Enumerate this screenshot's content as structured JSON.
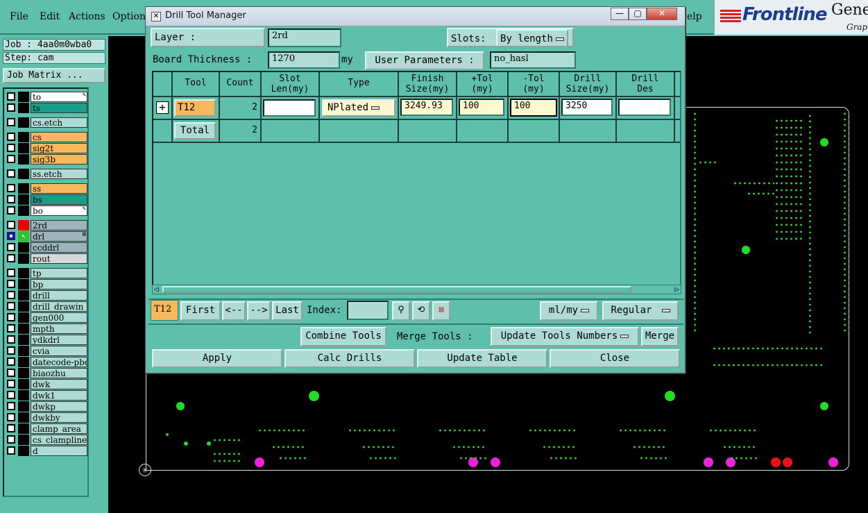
{
  "menubar": {
    "items": [
      "File",
      "Edit",
      "Actions",
      "Options"
    ],
    "help_fragment": "elp"
  },
  "logo": {
    "brand": "Frontline",
    "gen_fragment": "Gene",
    "grap_fragment": "Grap"
  },
  "job": {
    "job_line": "Job : 4aa0m0wba0",
    "step_line": "Step: cam",
    "matrix_button": "Job Matrix ..."
  },
  "layers": [
    {
      "name": "to",
      "color": "#ffffff",
      "mark": "✎"
    },
    {
      "name": "ts",
      "color": "#1a9e8a",
      "mark": ""
    },
    {
      "name": "cs.etch",
      "color": "#aedbd3",
      "mark": ""
    },
    {
      "name": "cs",
      "color": "#f6b85c",
      "mark": ""
    },
    {
      "name": "sig2t",
      "color": "#f6b85c",
      "mark": ""
    },
    {
      "name": "sig3b",
      "color": "#f6b85c",
      "mark": ""
    },
    {
      "name": "ss.etch",
      "color": "#aedbd3",
      "mark": ""
    },
    {
      "name": "ss",
      "color": "#f6b85c",
      "mark": ""
    },
    {
      "name": "bs",
      "color": "#1a9e8a",
      "mark": ""
    },
    {
      "name": "bo",
      "color": "#ffffff",
      "mark": "✎"
    },
    {
      "name": "2rd",
      "color": "#9fb3bd",
      "mark": ""
    },
    {
      "name": "drl",
      "color": "#9fb3bd",
      "mark": "⊞"
    },
    {
      "name": "ccddrl",
      "color": "#9fb3bd",
      "mark": ""
    },
    {
      "name": "rout",
      "color": "#d8d8d8",
      "mark": ""
    },
    {
      "name": "tp",
      "color": "#aedbd3",
      "mark": ""
    },
    {
      "name": "bp",
      "color": "#aedbd3",
      "mark": ""
    },
    {
      "name": "drill",
      "color": "#aedbd3",
      "mark": ""
    },
    {
      "name": "drill_drawin",
      "color": "#aedbd3",
      "mark": ""
    },
    {
      "name": "gen000",
      "color": "#aedbd3",
      "mark": ""
    },
    {
      "name": "mpth",
      "color": "#aedbd3",
      "mark": ""
    },
    {
      "name": "ydkdrl",
      "color": "#aedbd3",
      "mark": ""
    },
    {
      "name": "cvia",
      "color": "#aedbd3",
      "mark": ""
    },
    {
      "name": "datecode-pbo",
      "color": "#aedbd3",
      "mark": ""
    },
    {
      "name": "biaozhu",
      "color": "#aedbd3",
      "mark": ""
    },
    {
      "name": "dwk",
      "color": "#aedbd3",
      "mark": ""
    },
    {
      "name": "dwk1",
      "color": "#aedbd3",
      "mark": ""
    },
    {
      "name": "dwkp",
      "color": "#aedbd3",
      "mark": ""
    },
    {
      "name": "dwkby",
      "color": "#aedbd3",
      "mark": ""
    },
    {
      "name": "clamp_area",
      "color": "#aedbd3",
      "mark": ""
    },
    {
      "name": "cs_clampline",
      "color": "#aedbd3",
      "mark": ""
    },
    {
      "name": "d",
      "color": "#aedbd3",
      "mark": ""
    }
  ],
  "dialog": {
    "title": "Drill Tool Manager",
    "title_buttons": {
      "minimize": "—",
      "maximize": "▢",
      "close": "✕"
    },
    "layer_label": "Layer      :",
    "layer_value": "2rd",
    "slots_label": "Slots:",
    "slots_value": "By length",
    "board_thickness_label": "Board Thickness :",
    "board_thickness_value": "1270",
    "board_thickness_unit": "my",
    "user_params_label": "User Parameters :",
    "user_params_value": "no_hasl",
    "table": {
      "headers": [
        {
          "text": "Tool"
        },
        {
          "text": "Count"
        },
        {
          "text": "Slot\nLen(my)"
        },
        {
          "text": "Type"
        },
        {
          "text": "Finish\nSize(my)"
        },
        {
          "text": "+Tol\n(my)"
        },
        {
          "text": "-Tol\n(my)"
        },
        {
          "text": "Drill\nSize(my)"
        },
        {
          "text": "Drill\nDes"
        }
      ],
      "rows": [
        {
          "expand": "+",
          "tool": "T12",
          "count": "2",
          "slot_len": "",
          "type": "NPlated",
          "finish_size": "3249.93",
          "plus_tol": "100",
          "minus_tol": "100",
          "drill_size": "3250",
          "drill_des": ""
        }
      ],
      "total_label": "Total",
      "total_count": "2"
    },
    "nav": {
      "current_tool": "T12",
      "first": "First",
      "prev": "<--",
      "next": "-->",
      "last": "Last",
      "index_label": "Index:",
      "index_value": "",
      "units": "ml/my",
      "mode": "Regular"
    },
    "tools_row": {
      "combine": "Combine Tools",
      "merge_label": "Merge Tools :",
      "merge_option": "Update Tools Numbers",
      "merge_button": "Merge"
    },
    "actions": {
      "apply": "Apply",
      "calc": "Calc Drills",
      "update": "Update Table",
      "close": "Close"
    }
  },
  "colors": {
    "motif_bg": "#5fbfad",
    "pad_green": "#22dd22",
    "pad_magenta": "#ee22dd",
    "pad_red": "#ee1111"
  }
}
